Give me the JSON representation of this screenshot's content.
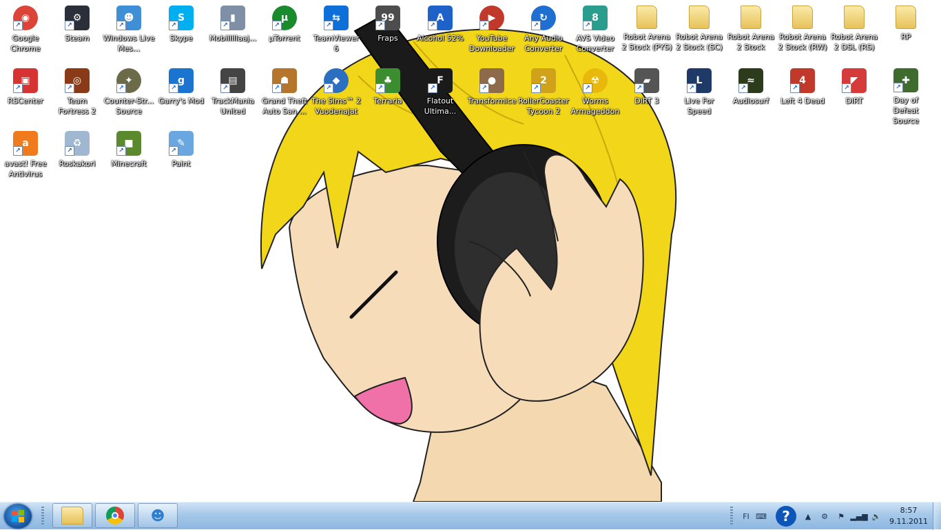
{
  "desktop": {
    "icons": [
      {
        "label": "Google Chrome",
        "icon": "chrome-icon",
        "color": "#db4437",
        "glyph": "◉",
        "round": true,
        "col": 0,
        "row": 0
      },
      {
        "label": "Steam",
        "icon": "steam-icon",
        "color": "#2a2f3a",
        "glyph": "⚙",
        "col": 1,
        "row": 0
      },
      {
        "label": "Windows Live Mes...",
        "icon": "messenger-icon",
        "color": "#3f8fd6",
        "glyph": "☻",
        "col": 2,
        "row": 0
      },
      {
        "label": "Skype",
        "icon": "skype-icon",
        "color": "#00aff0",
        "glyph": "S",
        "col": 3,
        "row": 0
      },
      {
        "label": "Mobiilillaaj...",
        "icon": "mobile-device-icon",
        "color": "#7f8fa6",
        "glyph": "▮",
        "col": 4,
        "row": 0
      },
      {
        "label": "µTorrent",
        "icon": "utorrent-icon",
        "color": "#1a8b2c",
        "glyph": "µ",
        "round": true,
        "col": 5,
        "row": 0
      },
      {
        "label": "TeamViewer 6",
        "icon": "teamviewer-icon",
        "color": "#0e6fd8",
        "glyph": "⇆",
        "col": 6,
        "row": 0
      },
      {
        "label": "Fraps",
        "icon": "fraps-icon",
        "color": "#4d4d4d",
        "glyph": "99",
        "col": 7,
        "row": 0
      },
      {
        "label": "Alcohol 52%",
        "icon": "alcohol-icon",
        "color": "#1e62c9",
        "glyph": "A",
        "col": 8,
        "row": 0
      },
      {
        "label": "YouTube Downloader",
        "icon": "youtube-downloader-icon",
        "color": "#c0392b",
        "glyph": "▶",
        "round": true,
        "col": 9,
        "row": 0
      },
      {
        "label": "Any Audio Converter",
        "icon": "audio-converter-icon",
        "color": "#1f6fd1",
        "glyph": "↻",
        "round": true,
        "col": 10,
        "row": 0
      },
      {
        "label": "AVS Video Converter",
        "icon": "avs-video-icon",
        "color": "#2a9d8f",
        "glyph": "8",
        "col": 11,
        "row": 0
      },
      {
        "label": "Robot Arena 2 Stock (PYS)",
        "icon": "folder-icon",
        "folder": true,
        "col": 12,
        "row": 0
      },
      {
        "label": "Robot Arena 2 Stock (SC)",
        "icon": "folder-icon",
        "folder": true,
        "col": 13,
        "row": 0
      },
      {
        "label": "Robot Arena 2 Stock",
        "icon": "folder-icon",
        "folder": true,
        "col": 14,
        "row": 0
      },
      {
        "label": "Robot Arena 2 Stock (RW)",
        "icon": "folder-icon",
        "folder": true,
        "col": 15,
        "row": 0
      },
      {
        "label": "Robot Arena 2 DSL (RS)",
        "icon": "folder-icon",
        "folder": true,
        "col": 16,
        "row": 0
      },
      {
        "label": "RP",
        "icon": "folder-icon",
        "folder": true,
        "col": 17,
        "row": 0
      },
      {
        "label": "RSCenter",
        "icon": "rscenter-icon",
        "color": "#d63333",
        "glyph": "▣",
        "col": 0,
        "row": 1
      },
      {
        "label": "Team Fortress 2",
        "icon": "tf2-icon",
        "color": "#8a3a16",
        "glyph": "◎",
        "col": 1,
        "row": 1
      },
      {
        "label": "Counter-Str... Source",
        "icon": "counter-strike-icon",
        "color": "#6b6b4a",
        "glyph": "✦",
        "round": true,
        "col": 2,
        "row": 1
      },
      {
        "label": "Garry's Mod",
        "icon": "garrys-mod-icon",
        "color": "#1b74d0",
        "glyph": "g",
        "col": 3,
        "row": 1
      },
      {
        "label": "TrackMania United",
        "icon": "trackmania-icon",
        "color": "#444444",
        "glyph": "▤",
        "col": 4,
        "row": 1
      },
      {
        "label": "Grand Theft Auto San ...",
        "icon": "gta-icon",
        "color": "#b5762b",
        "glyph": "☗",
        "col": 5,
        "row": 1
      },
      {
        "label": "The Sims™ 2 Vuodenajat",
        "icon": "sims-icon",
        "color": "#2a6fc0",
        "glyph": "◆",
        "round": true,
        "col": 6,
        "row": 1
      },
      {
        "label": "Terraria",
        "icon": "terraria-icon",
        "color": "#3c8d2f",
        "glyph": "♣",
        "col": 7,
        "row": 1
      },
      {
        "label": "Flatout Ultima...",
        "icon": "flatout-icon",
        "color": "#1a1a1a",
        "glyph": "F",
        "col": 8,
        "row": 1
      },
      {
        "label": "Transformice",
        "icon": "transformice-icon",
        "color": "#8c6a4a",
        "glyph": "●",
        "col": 9,
        "row": 1
      },
      {
        "label": "RollerCoaster Tycoon 2",
        "icon": "rollercoaster-icon",
        "color": "#d0a21a",
        "glyph": "2",
        "col": 10,
        "row": 1
      },
      {
        "label": "Worms Armageddon",
        "icon": "worms-icon",
        "color": "#e8b90c",
        "glyph": "☢",
        "round": true,
        "col": 11,
        "row": 1
      },
      {
        "label": "DiRT 3",
        "icon": "dirt3-icon",
        "color": "#555555",
        "glyph": "▰",
        "col": 12,
        "row": 1
      },
      {
        "label": "Live For Speed",
        "icon": "live-for-speed-icon",
        "color": "#1f3a66",
        "glyph": "L",
        "col": 13,
        "row": 1
      },
      {
        "label": "Audiosurf",
        "icon": "audiosurf-icon",
        "color": "#2b3b1c",
        "glyph": "≈",
        "col": 14,
        "row": 1
      },
      {
        "label": "Left 4 Dead",
        "icon": "left4dead-icon",
        "color": "#c0392b",
        "glyph": "4",
        "col": 15,
        "row": 1
      },
      {
        "label": "DiRT",
        "icon": "dirt-icon",
        "color": "#d63b3b",
        "glyph": "◤",
        "col": 16,
        "row": 1
      },
      {
        "label": "Day of Defeat Source",
        "icon": "day-of-defeat-icon",
        "color": "#3f6b2f",
        "glyph": "✚",
        "col": 17,
        "row": 1
      },
      {
        "label": "avast! Free Antivirus",
        "icon": "avast-icon",
        "color": "#f07b1d",
        "glyph": "a",
        "col": 0,
        "row": 2
      },
      {
        "label": "Roskakori",
        "icon": "recycle-bin-icon",
        "color": "#9fb7d1",
        "glyph": "♻",
        "col": 1,
        "row": 2
      },
      {
        "label": "Minecraft",
        "icon": "minecraft-icon",
        "color": "#5b8a2e",
        "glyph": "■",
        "col": 2,
        "row": 2
      },
      {
        "label": "Paint",
        "icon": "paint-icon",
        "color": "#6aa6e0",
        "glyph": "✎",
        "col": 3,
        "row": 2
      }
    ]
  },
  "taskbar": {
    "pinned": [
      {
        "name": "explorer",
        "icon": "folder-icon"
      },
      {
        "name": "chrome",
        "icon": "chrome-icon"
      },
      {
        "name": "messenger",
        "icon": "messenger-icon"
      }
    ],
    "language": "FI",
    "clock": {
      "time": "8:57",
      "date": "9.11.2011"
    }
  }
}
